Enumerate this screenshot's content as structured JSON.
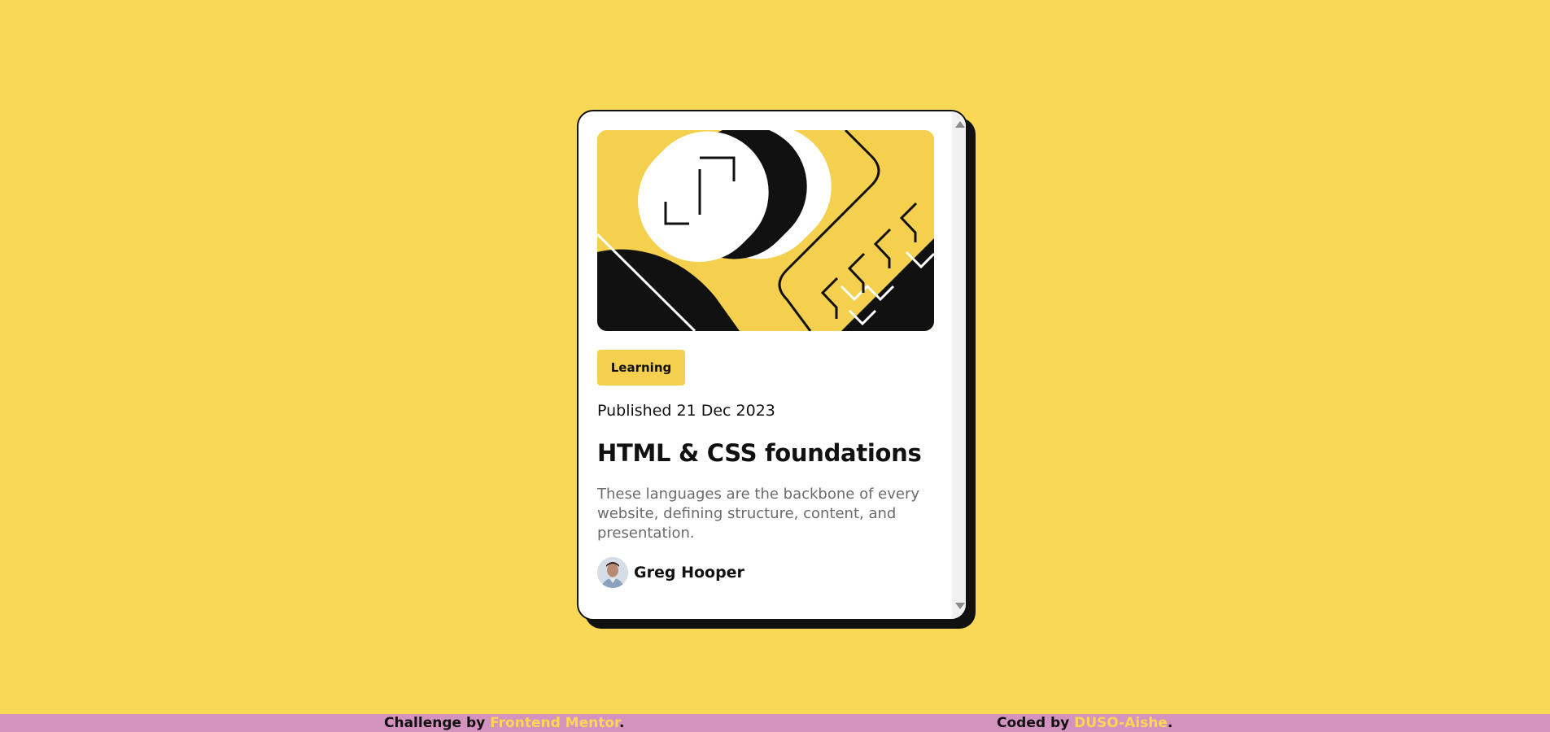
{
  "card": {
    "tag": "Learning",
    "published": "Published 21 Dec 2023",
    "title": "HTML & CSS foundations",
    "description": "These languages are the backbone of every website, defining structure, content, and presentation.",
    "author": "Greg Hooper"
  },
  "footer": {
    "challenge_prefix": "Challenge by",
    "challenge_link": "Frontend Mentor",
    "coded_prefix": "Coded by",
    "coded_link": "DUSO-Aishe",
    "period": "."
  },
  "colors": {
    "background": "#f9d855",
    "accent": "#f4d04e",
    "footer": "#d393be",
    "text": "#111111"
  },
  "icons": {
    "hero": "illustration-article",
    "avatar": "author-avatar",
    "scroll_up": "scroll-up-arrow-icon",
    "scroll_down": "scroll-down-arrow-icon"
  }
}
